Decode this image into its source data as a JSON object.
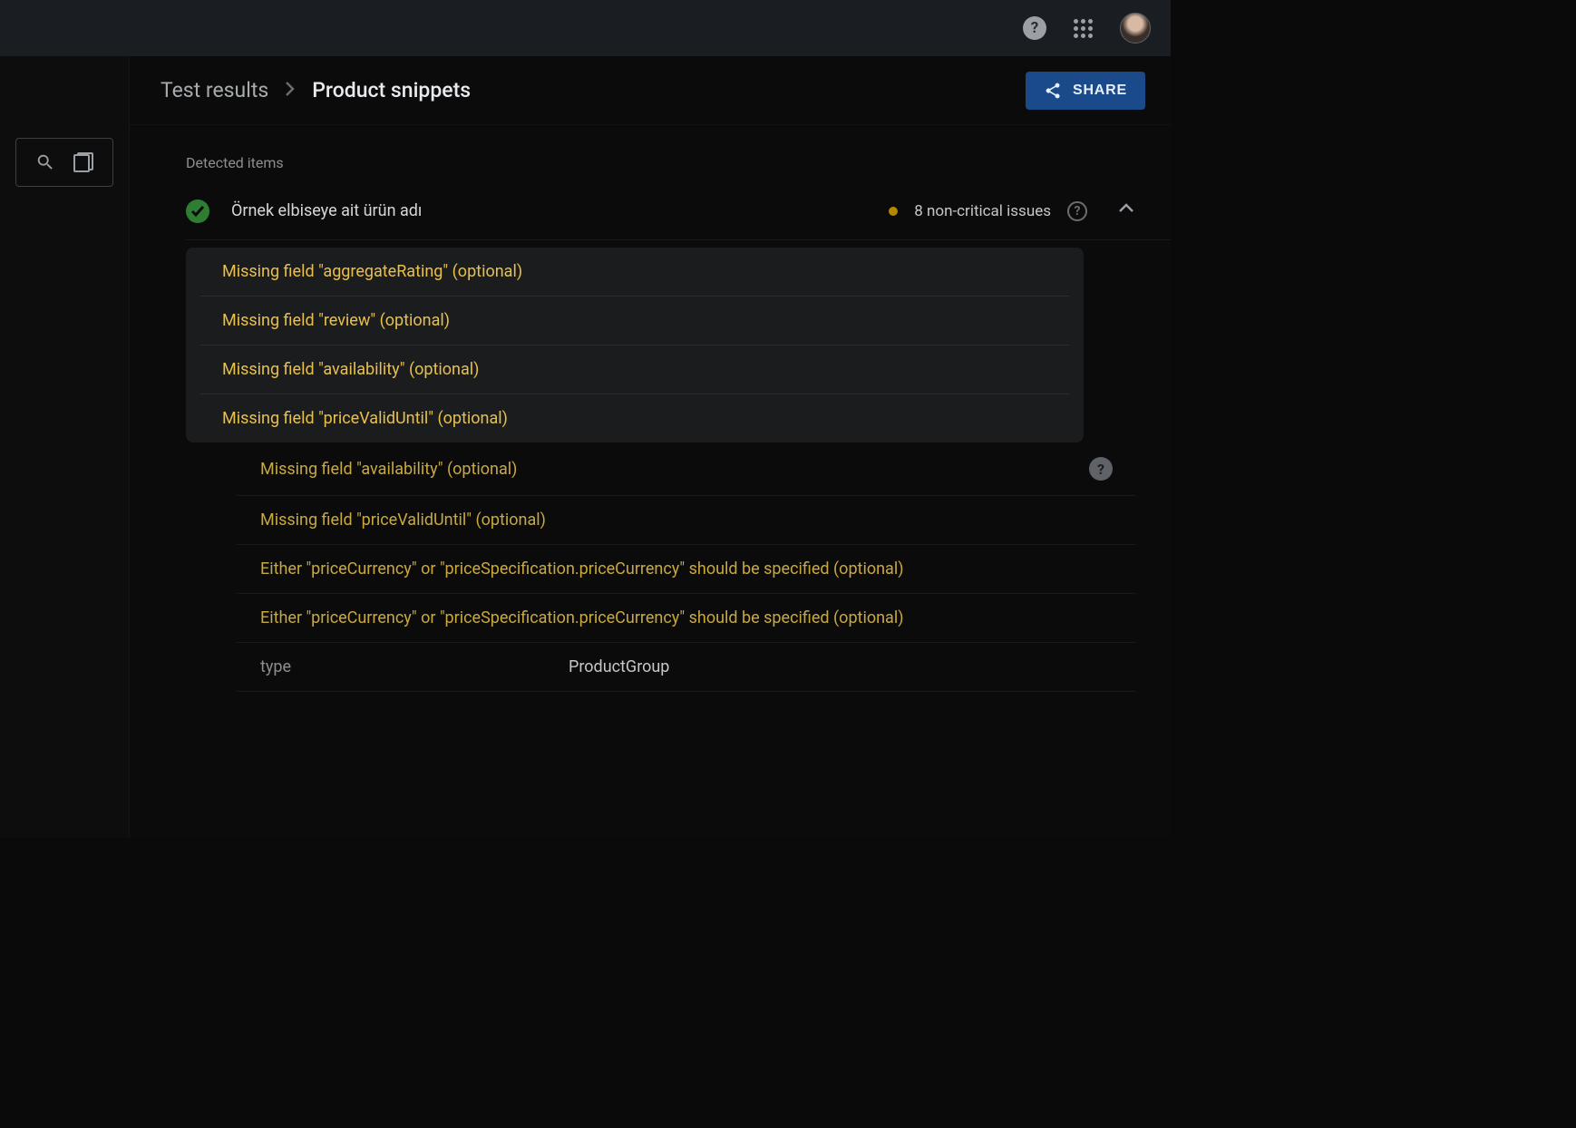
{
  "breadcrumb": {
    "root": "Test results",
    "current": "Product snippets"
  },
  "share_label": "SHARE",
  "detected_label": "Detected items",
  "item": {
    "title": "Örnek elbiseye ait ürün adı",
    "issues_text": "8 non-critical issues"
  },
  "card_issues": [
    "Missing field \"aggregateRating\" (optional)",
    "Missing field \"review\" (optional)",
    "Missing field \"availability\" (optional)",
    "Missing field \"priceValidUntil\" (optional)"
  ],
  "plain_issues": [
    "Missing field \"availability\" (optional)",
    "Missing field \"priceValidUntil\" (optional)",
    "Either \"priceCurrency\" or \"priceSpecification.priceCurrency\" should be specified (optional)",
    "Either \"priceCurrency\" or \"priceSpecification.priceCurrency\" should be specified (optional)"
  ],
  "properties": [
    {
      "key": "type",
      "value": "ProductGroup"
    }
  ]
}
